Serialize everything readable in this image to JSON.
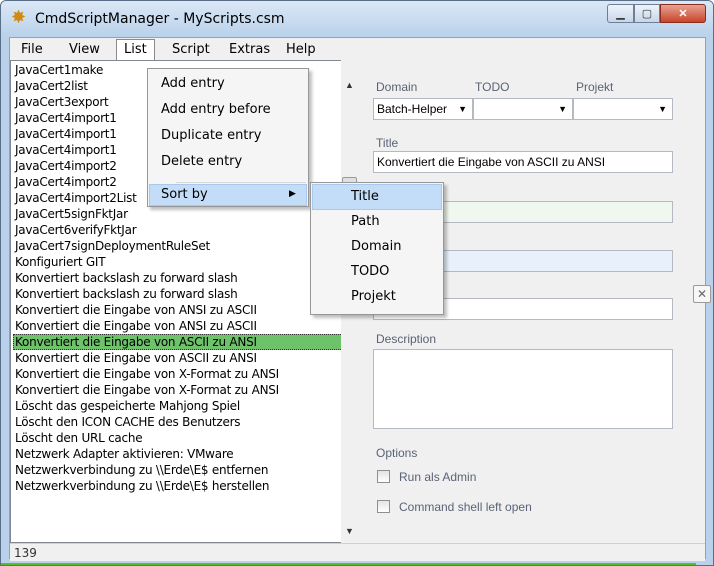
{
  "window": {
    "title": "CmdScriptManager - MyScripts.csm",
    "min_glyph": "▁",
    "max_glyph": "▢",
    "close_glyph": "✕"
  },
  "menubar": [
    {
      "label": "File"
    },
    {
      "label": "View"
    },
    {
      "label": "List"
    },
    {
      "label": "Script"
    },
    {
      "label": "Extras"
    },
    {
      "label": "Help"
    }
  ],
  "list_menu": {
    "items": [
      "Add entry",
      "Add entry before",
      "Duplicate entry",
      "Delete entry"
    ],
    "sort_by": "Sort by"
  },
  "sort_submenu": [
    "Title",
    "Path",
    "Domain",
    "TODO",
    "Projekt"
  ],
  "entries": [
    "JavaCert1make",
    "JavaCert2list",
    "JavaCert3export",
    "JavaCert4import1",
    "JavaCert4import1",
    "JavaCert4import1",
    "JavaCert4import2",
    "JavaCert4import2",
    "JavaCert4import2List",
    "JavaCert5signFktJar",
    "JavaCert6verifyFktJar",
    "JavaCert7signDeploymentRuleSet",
    "Konfiguriert GIT",
    "Konvertiert backslash zu forward slash",
    "Konvertiert backslash zu forward slash",
    "Konvertiert die Eingabe von ANSI zu ASCII",
    "Konvertiert die Eingabe von ANSI zu ASCII",
    "Konvertiert die Eingabe von ASCII zu ANSI",
    "Konvertiert die Eingabe von ASCII zu ANSI",
    "Konvertiert die Eingabe von X-Format zu ANSI",
    "Konvertiert die Eingabe von X-Format zu ANSI",
    "Löscht das gespeicherte Mahjong Spiel",
    "Löscht den ICON CACHE des Benutzers",
    "Löscht den URL cache",
    "Netzwerk Adapter aktivieren: VMware",
    "Netzwerkverbindung zu \\\\Erde\\E$ entfernen",
    "Netzwerkverbindung zu \\\\Erde\\E$ herstellen"
  ],
  "selected_index": 17,
  "form": {
    "domain_label": "Domain",
    "todo_label": "TODO",
    "projekt_label": "Projekt",
    "domain_value": "Batch-Helper",
    "todo_value": "",
    "projekt_value": "",
    "title_label": "Title",
    "title_value": "Konvertiert die Eingabe von ASCII zu ANSI",
    "working_dir_label_partial": "ctory",
    "browse_glyph": "✕",
    "description_label": "Description",
    "options_label": "Options",
    "run_as_admin": "Run als Admin",
    "shell_left_open": "Command shell left open"
  },
  "status": {
    "count": "139"
  },
  "colors": {
    "selection": "#6dc26a",
    "status_accent": "#4fc12d",
    "menu_highlight": "#c3dcf7"
  }
}
